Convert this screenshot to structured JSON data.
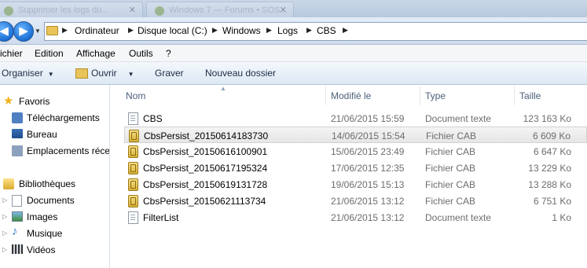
{
  "tabs": [
    {
      "title": "Supprimer les logs du..."
    },
    {
      "title": "Windows 7 — Forums • SOS..."
    }
  ],
  "address": {
    "crumbs": [
      "Ordinateur",
      "Disque local (C:)",
      "Windows",
      "Logs",
      "CBS"
    ]
  },
  "menubar": {
    "items": [
      "ichier",
      "Edition",
      "Affichage",
      "Outils",
      "?"
    ]
  },
  "commandbar": {
    "organiser": "Organiser",
    "ouvrir": "Ouvrir",
    "graver": "Graver",
    "nouveau_dossier": "Nouveau dossier"
  },
  "navpane": {
    "favoris": "Favoris",
    "telechargements": "Téléchargements",
    "bureau": "Bureau",
    "emplacements": "Emplacements récen",
    "bibliotheques": "Bibliothèques",
    "documents": "Documents",
    "images": "Images",
    "musique": "Musique",
    "videos": "Vidéos"
  },
  "columns": {
    "nom": "Nom",
    "modifie": "Modifié le",
    "type": "Type",
    "taille": "Taille"
  },
  "files": [
    {
      "name": "CBS",
      "date": "21/06/2015 15:59",
      "type": "Document texte",
      "size": "123 163 Ko",
      "icon": "text-file-icon"
    },
    {
      "name": "CbsPersist_20150614183730",
      "date": "14/06/2015 15:54",
      "type": "Fichier CAB",
      "size": "6 609 Ko",
      "icon": "cab-file-icon"
    },
    {
      "name": "CbsPersist_20150616100901",
      "date": "15/06/2015 23:49",
      "type": "Fichier CAB",
      "size": "6 647 Ko",
      "icon": "cab-file-icon"
    },
    {
      "name": "CbsPersist_20150617195324",
      "date": "17/06/2015 12:35",
      "type": "Fichier CAB",
      "size": "13 229 Ko",
      "icon": "cab-file-icon"
    },
    {
      "name": "CbsPersist_20150619131728",
      "date": "19/06/2015 15:13",
      "type": "Fichier CAB",
      "size": "13 288 Ko",
      "icon": "cab-file-icon"
    },
    {
      "name": "CbsPersist_20150621113734",
      "date": "21/06/2015 13:12",
      "type": "Fichier CAB",
      "size": "6 751 Ko",
      "icon": "cab-file-icon"
    },
    {
      "name": "FilterList",
      "date": "21/06/2015 13:12",
      "type": "Document texte",
      "size": "1 Ko",
      "icon": "text-file-icon"
    }
  ]
}
